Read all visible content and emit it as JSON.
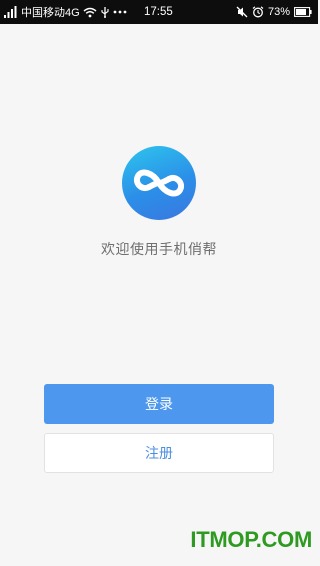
{
  "status_bar": {
    "carrier": "中国移动4G",
    "time": "17:55",
    "battery": "73%"
  },
  "app": {
    "welcome": "欢迎使用手机俏帮"
  },
  "buttons": {
    "login": "登录",
    "register": "注册"
  },
  "watermark": "ITMOP.COM",
  "colors": {
    "primary": "#4d98ee",
    "logo_top": "#2ec5ee",
    "logo_bottom": "#3a76e0",
    "background": "#f6f6f6",
    "watermark": "#2f9a22"
  },
  "icons": [
    "signal-icon",
    "wifi-icon",
    "usb-icon",
    "more-icon",
    "mute-icon",
    "alarm-icon",
    "battery-icon",
    "infinity-logo-icon"
  ]
}
